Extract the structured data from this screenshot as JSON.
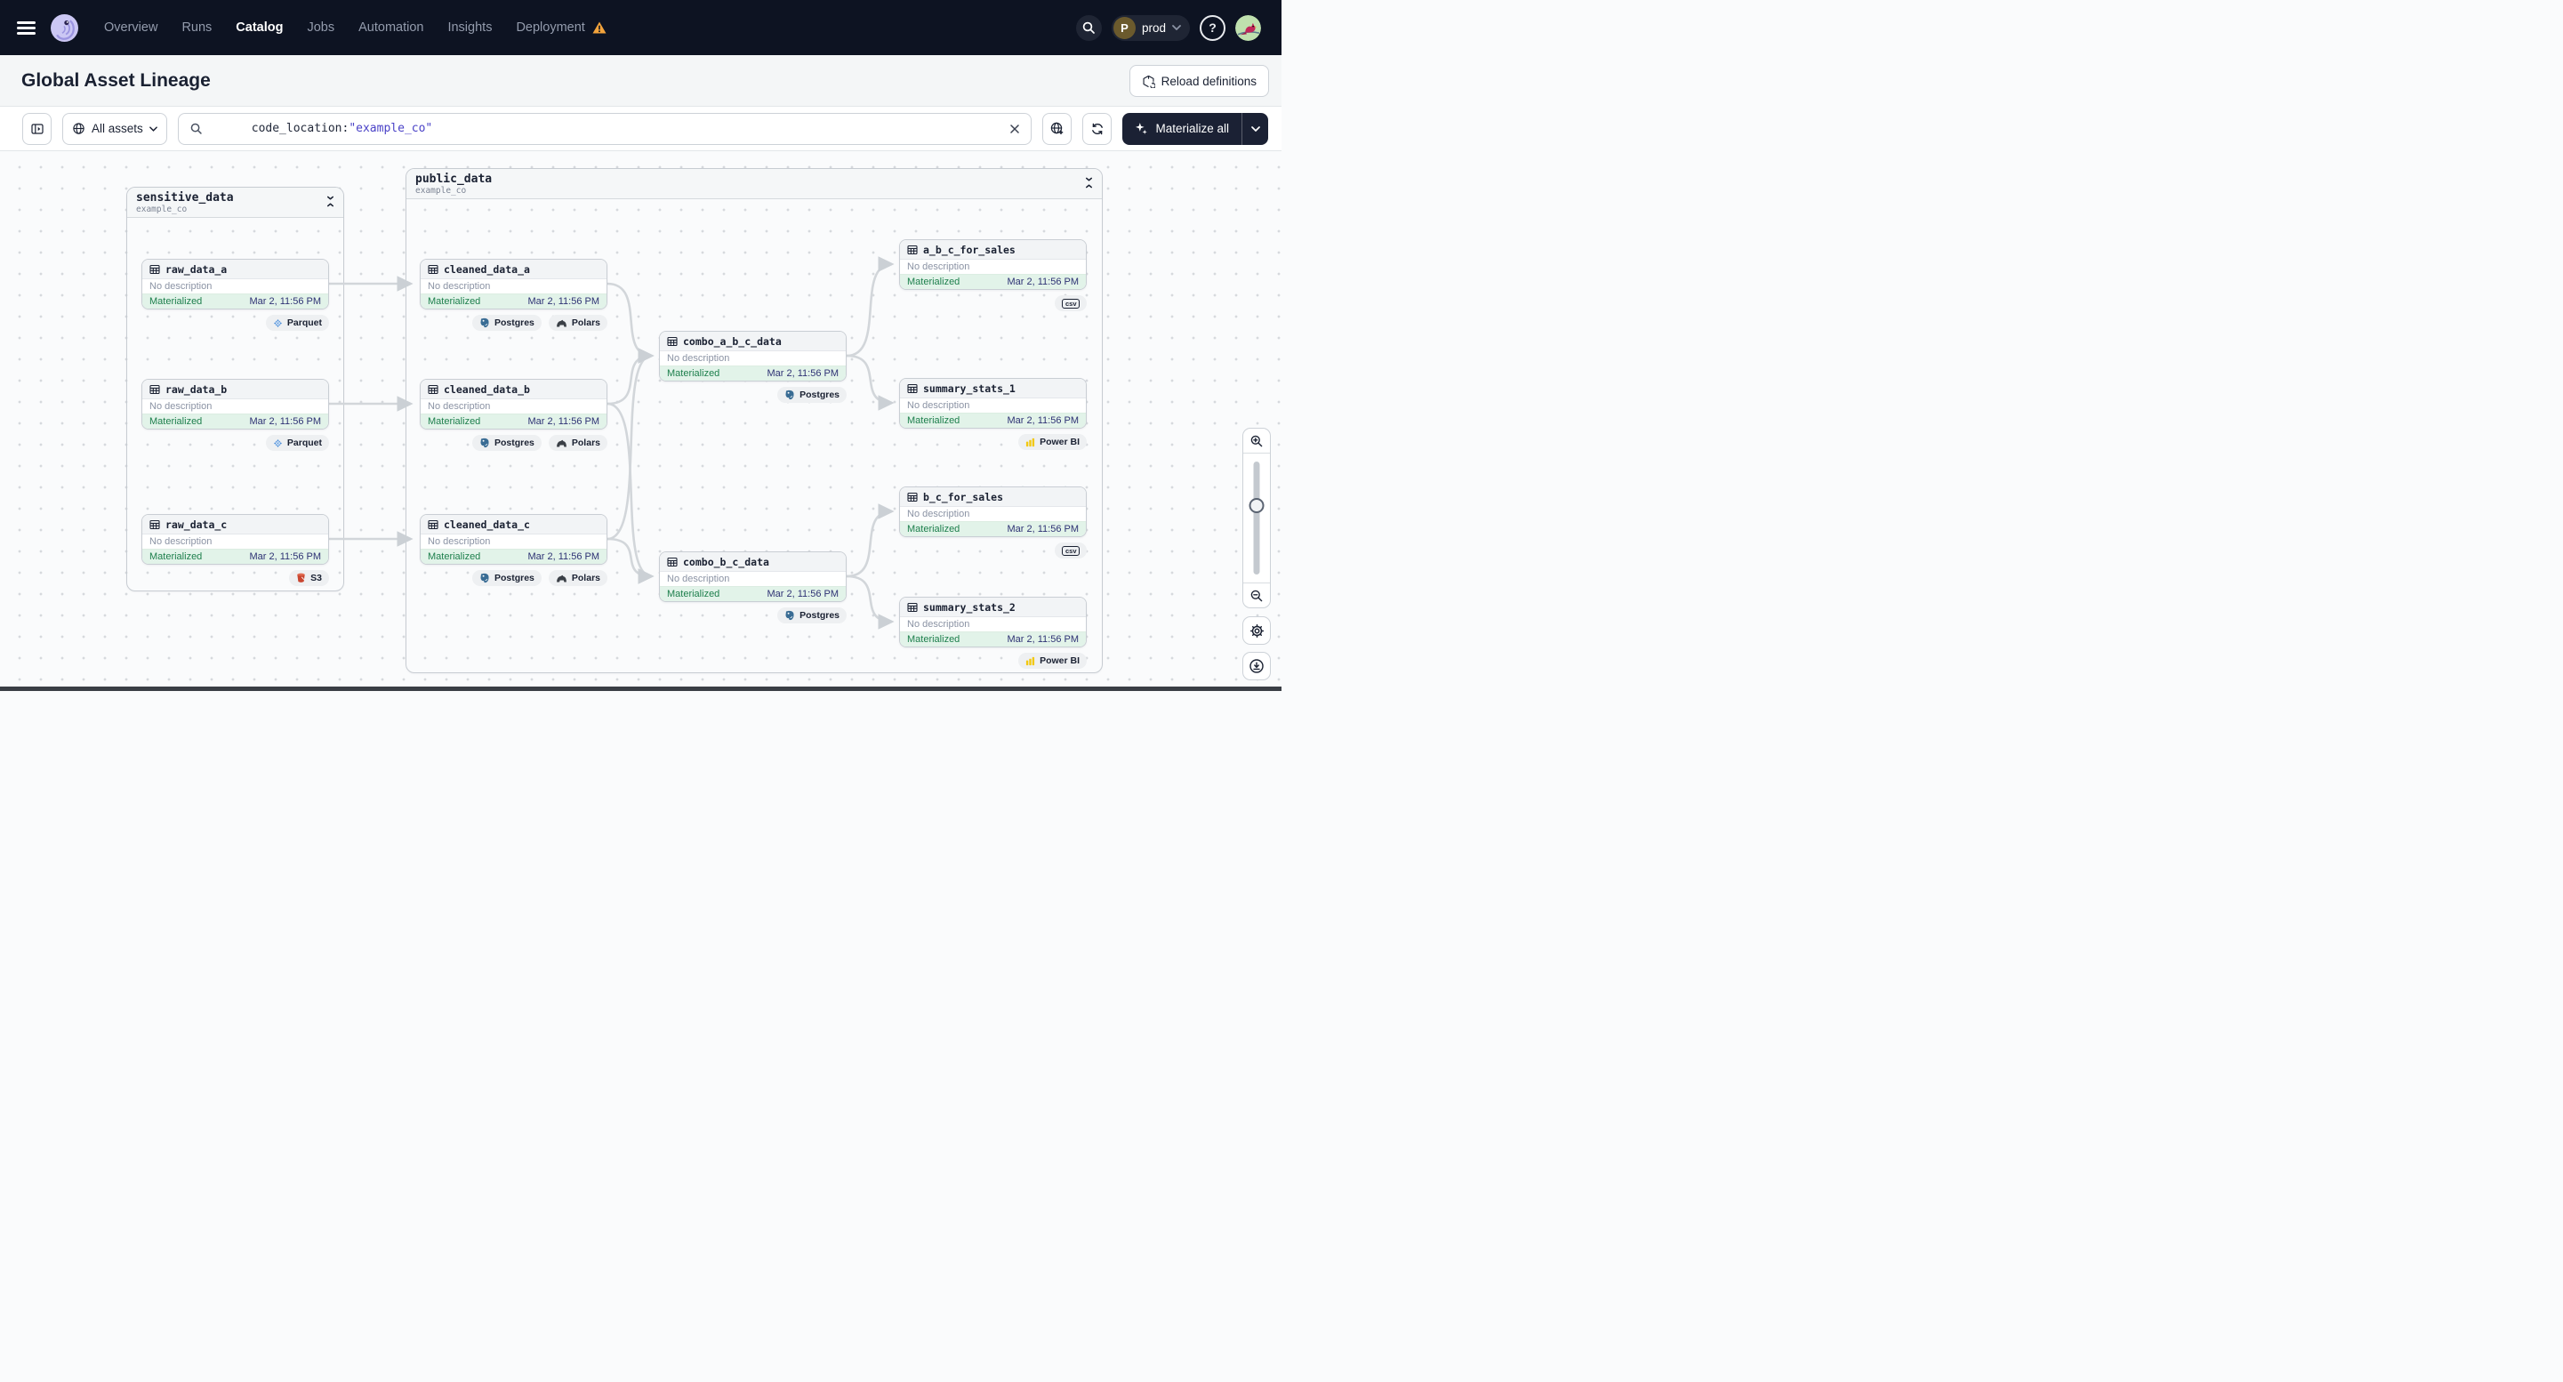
{
  "nav": {
    "items": [
      "Overview",
      "Runs",
      "Catalog",
      "Jobs",
      "Automation",
      "Insights",
      "Deployment"
    ],
    "active_item": "Catalog",
    "environment": {
      "initial": "P",
      "name": "prod"
    }
  },
  "header": {
    "title": "Global Asset Lineage",
    "reload_button": "Reload definitions"
  },
  "toolbar": {
    "filter_label": "All assets",
    "search_field": "code_location:",
    "search_term_quoted": "\"example_co\"",
    "materialize_button": "Materialize all"
  },
  "groups": {
    "sensitive": {
      "name": "sensitive_data",
      "location": "example_co"
    },
    "public": {
      "name": "public_data",
      "location": "example_co"
    }
  },
  "nodes": {
    "raw_data_a": {
      "name": "raw_data_a",
      "description": "No description",
      "status": "Materialized",
      "timestamp": "Mar 2, 11:56 PM",
      "badges": [
        {
          "label": "Parquet",
          "icon": "parquet-icon"
        }
      ]
    },
    "raw_data_b": {
      "name": "raw_data_b",
      "description": "No description",
      "status": "Materialized",
      "timestamp": "Mar 2, 11:56 PM",
      "badges": [
        {
          "label": "Parquet",
          "icon": "parquet-icon"
        }
      ]
    },
    "raw_data_c": {
      "name": "raw_data_c",
      "description": "No description",
      "status": "Materialized",
      "timestamp": "Mar 2, 11:56 PM",
      "badges": [
        {
          "label": "S3",
          "icon": "s3-icon"
        }
      ]
    },
    "cleaned_data_a": {
      "name": "cleaned_data_a",
      "description": "No description",
      "status": "Materialized",
      "timestamp": "Mar 2, 11:56 PM",
      "badges": [
        {
          "label": "Postgres",
          "icon": "postgres-icon"
        },
        {
          "label": "Polars",
          "icon": "polars-icon"
        }
      ]
    },
    "cleaned_data_b": {
      "name": "cleaned_data_b",
      "description": "No description",
      "status": "Materialized",
      "timestamp": "Mar 2, 11:56 PM",
      "badges": [
        {
          "label": "Postgres",
          "icon": "postgres-icon"
        },
        {
          "label": "Polars",
          "icon": "polars-icon"
        }
      ]
    },
    "cleaned_data_c": {
      "name": "cleaned_data_c",
      "description": "No description",
      "status": "Materialized",
      "timestamp": "Mar 2, 11:56 PM",
      "badges": [
        {
          "label": "Postgres",
          "icon": "postgres-icon"
        },
        {
          "label": "Polars",
          "icon": "polars-icon"
        }
      ]
    },
    "combo_a_b_c_data": {
      "name": "combo_a_b_c_data",
      "description": "No description",
      "status": "Materialized",
      "timestamp": "Mar 2, 11:56 PM",
      "badges": [
        {
          "label": "Postgres",
          "icon": "postgres-icon"
        }
      ]
    },
    "combo_b_c_data": {
      "name": "combo_b_c_data",
      "description": "No description",
      "status": "Materialized",
      "timestamp": "Mar 2, 11:56 PM",
      "badges": [
        {
          "label": "Postgres",
          "icon": "postgres-icon"
        }
      ]
    },
    "a_b_c_for_sales": {
      "name": "a_b_c_for_sales",
      "description": "No description",
      "status": "Materialized",
      "timestamp": "Mar 2, 11:56 PM",
      "badges": [
        {
          "label": "csv",
          "icon": "csv-icon"
        }
      ]
    },
    "summary_stats_1": {
      "name": "summary_stats_1",
      "description": "No description",
      "status": "Materialized",
      "timestamp": "Mar 2, 11:56 PM",
      "badges": [
        {
          "label": "Power BI",
          "icon": "powerbi-icon"
        }
      ]
    },
    "b_c_for_sales": {
      "name": "b_c_for_sales",
      "description": "No description",
      "status": "Materialized",
      "timestamp": "Mar 2, 11:56 PM",
      "badges": [
        {
          "label": "csv",
          "icon": "csv-icon"
        }
      ]
    },
    "summary_stats_2": {
      "name": "summary_stats_2",
      "description": "No description",
      "status": "Materialized",
      "timestamp": "Mar 2, 11:56 PM",
      "badges": [
        {
          "label": "Power BI",
          "icon": "powerbi-icon"
        }
      ]
    }
  },
  "colors": {
    "nav_background": "#0D1322",
    "materialized_green": "#1D7F4C",
    "timestamp_indigo": "#2E3274",
    "search_term_indigo": "#4A42C7",
    "warning_amber": "#F2A33C",
    "powerbi_yellow": "#F2C811",
    "postgres_blue": "#396C94",
    "parquet_blue": "#4E8FD9",
    "s3_red": "#C9452F",
    "edge_gray": "#D2D6DA"
  }
}
